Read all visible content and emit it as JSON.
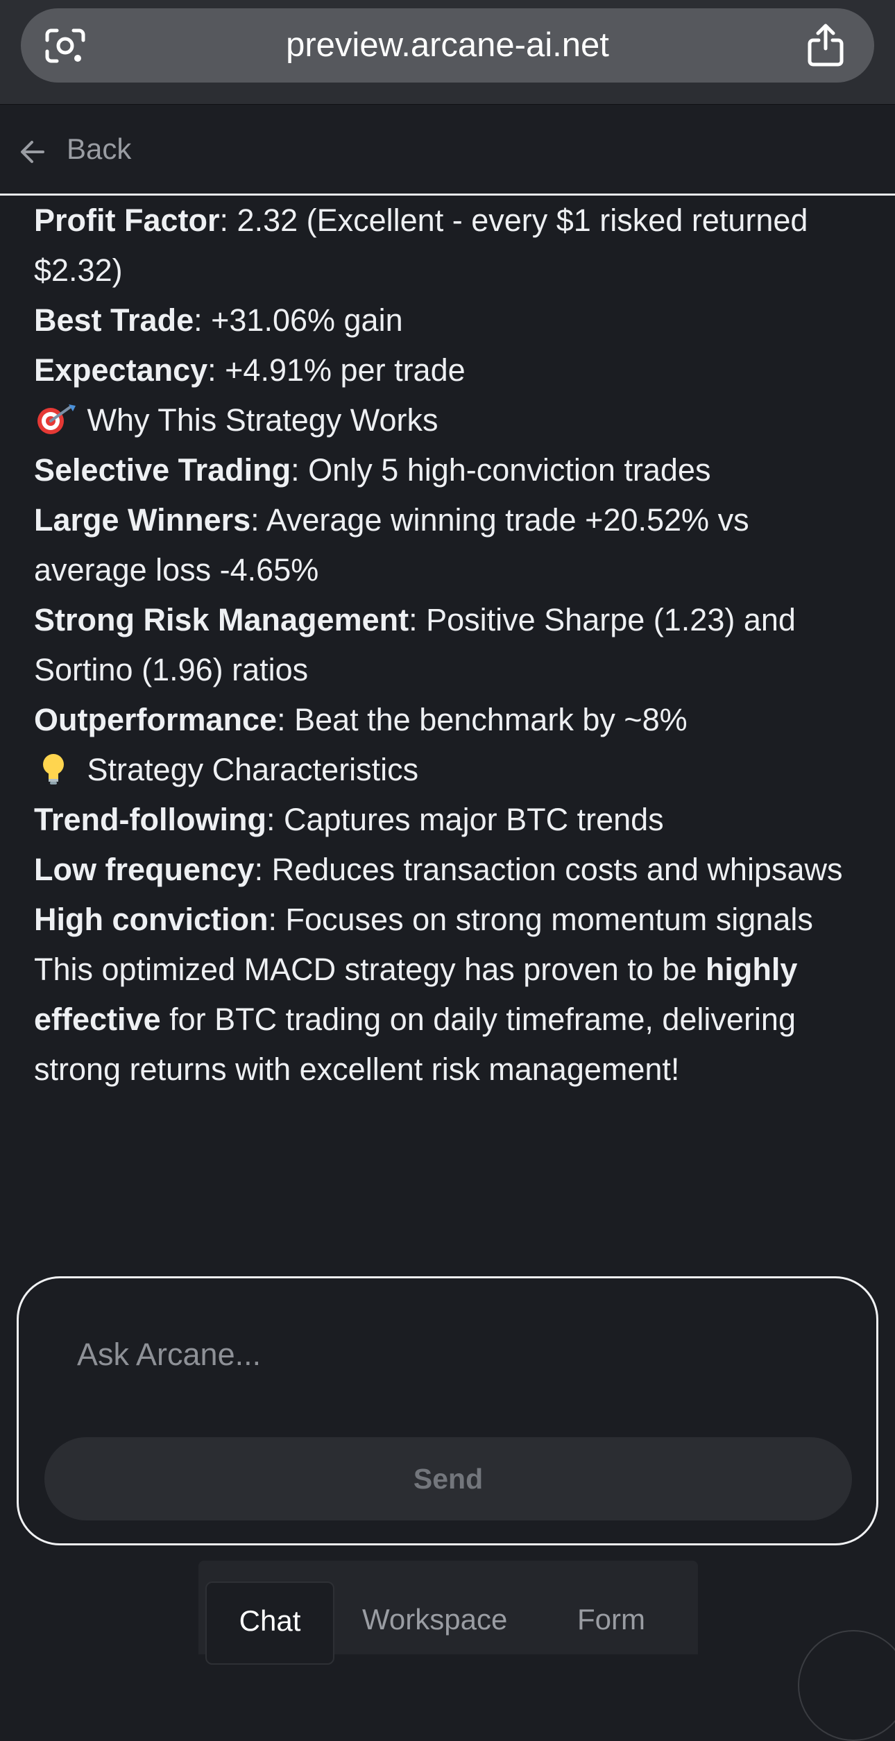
{
  "browser": {
    "url": "preview.arcane-ai.net",
    "left_icon": "google-lens-icon",
    "right_icon": "share-icon"
  },
  "nav": {
    "back_label": "Back",
    "back_icon": "arrow-left-icon"
  },
  "message": {
    "lines": [
      {
        "bold": "Profit Factor",
        "text": ": 2.32 (Excellent - every $1 risked returned $2.32)"
      },
      {
        "bold": "Best Trade",
        "text": ": +31.06% gain"
      },
      {
        "bold": "Expectancy",
        "text": ": +4.91% per trade"
      },
      {
        "emoji": "🎯",
        "emoji_icon": "target-dart-icon",
        "text": "Why This Strategy Works"
      },
      {
        "bold": "Selective Trading",
        "text": ": Only 5 high-conviction trades"
      },
      {
        "bold": "Large Winners",
        "text": ": Average winning trade +20.52% vs average loss -4.65%"
      },
      {
        "bold": "Strong Risk Management",
        "text": ": Positive Sharpe (1.23) and Sortino (1.96) ratios"
      },
      {
        "bold": "Outperformance",
        "text": ": Beat the benchmark by ~8%"
      },
      {
        "emoji": "💡",
        "emoji_icon": "light-bulb-icon",
        "text": "Strategy Characteristics"
      },
      {
        "bold": "Trend-following",
        "text": ": Captures major BTC trends"
      },
      {
        "bold": "Low frequency",
        "text": ": Reduces transaction costs and whipsaws"
      },
      {
        "bold": "High conviction",
        "text": ": Focuses on strong momentum signals"
      }
    ],
    "conclusion": {
      "before": "This optimized MACD strategy has proven to be ",
      "bold": "highly effective",
      "after": " for BTC trading on daily timeframe, delivering strong returns with excellent risk management!"
    }
  },
  "composer": {
    "placeholder": "Ask Arcane...",
    "value": "",
    "send_label": "Send"
  },
  "tabs": [
    {
      "label": "Chat",
      "active": true
    },
    {
      "label": "Workspace",
      "active": false
    },
    {
      "label": "Form",
      "active": false
    }
  ],
  "colors": {
    "background": "#1b1d22",
    "text": "#eef0f3",
    "muted": "#9a9da3",
    "url_pill": "#56585d",
    "send_button": "#2b2d32"
  }
}
